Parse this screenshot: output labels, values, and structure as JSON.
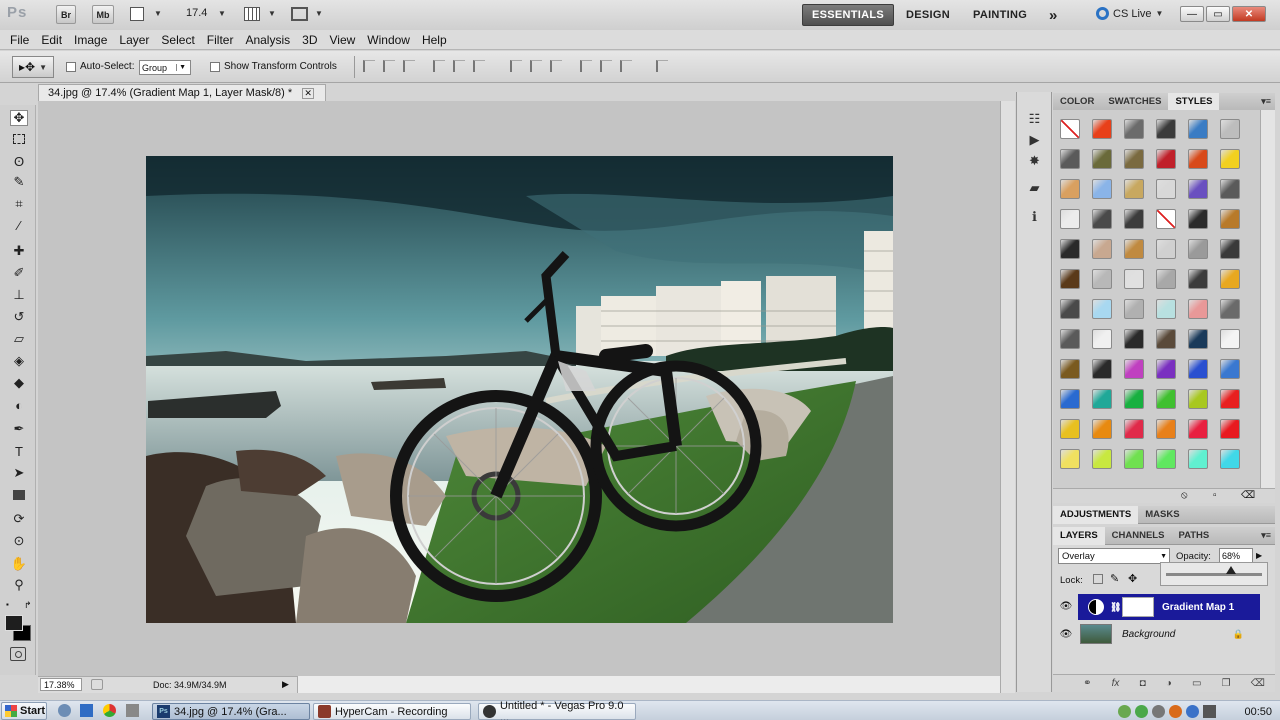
{
  "app": {
    "logo": "Ps",
    "bridge_label": "Br",
    "minibridge_label": "Mb",
    "zoom_value": "17.4",
    "workspaces": [
      "ESSENTIALS",
      "DESIGN",
      "PAINTING"
    ],
    "more_label": "»",
    "cs_live": "CS Live",
    "window_controls": [
      "—",
      "▭",
      "✕"
    ]
  },
  "menu": [
    "File",
    "Edit",
    "Image",
    "Layer",
    "Select",
    "Filter",
    "Analysis",
    "3D",
    "View",
    "Window",
    "Help"
  ],
  "options": {
    "auto_select_label": "Auto-Select:",
    "auto_select_value": "Group",
    "transform_label": "Show Transform Controls"
  },
  "document": {
    "tab_title": "34.jpg @ 17.4% (Gradient Map 1, Layer Mask/8) *",
    "close": "✕",
    "zoom_status": "17.38%",
    "doc_status": "Doc: 34.9M/34.9M"
  },
  "styles_panel": {
    "tabs": [
      "COLOR",
      "SWATCHES",
      "STYLES"
    ],
    "active_tab": "STYLES",
    "swatches": [
      "none",
      "#e8401a",
      "#6b6b6b",
      "#3b3b3b",
      "#3a7cc4",
      "#bdbdbd",
      "#5a5a5a",
      "#6a6a3a",
      "#7a6a40",
      "#c0202a",
      "#d84a1a",
      "#f2d020",
      "#d9a060",
      "#8ab4e8",
      "#c8a860",
      "#d8d8d8",
      "#6a50c0",
      "#5a5a5a",
      "#ececec",
      "#4a4a4a",
      "#3c3c3c",
      "none",
      "#2c2c2c",
      "#b87a2a",
      "#2a2a2a",
      "#c8a890",
      "#c08a40",
      "#d0d0d0",
      "#9a9a9a",
      "#3a3a3a",
      "#5a3a1a",
      "#b8b8b8",
      "#e0e0e0",
      "#a8a8a8",
      "#3c3c3c",
      "#e8a820",
      "#4a4a4a",
      "#a8d8f0",
      "#b0b0b0",
      "#b8e0e0",
      "#e89898",
      "#6a6a6a",
      "#5a5a5a",
      "#f0f0f0",
      "#2a2a2a",
      "#5a4a3a",
      "#1a3a5a",
      "#f4f4f4",
      "#7a5a20",
      "#2a2a2a",
      "#c040c0",
      "#7a30c0",
      "#2a50d0",
      "#3a78d0",
      "#2a6ad0",
      "#20a898",
      "#18b040",
      "#40c030",
      "#a8c820",
      "#e82020",
      "#e8c020",
      "#e88a10",
      "#e02a4a",
      "#e8801a",
      "#e82040",
      "#e81a20",
      "#f0e060",
      "#c8e840",
      "#70e050",
      "#60e860",
      "#60f0d0",
      "#40d8e8"
    ]
  },
  "adjustments_panel": {
    "tabs": [
      "ADJUSTMENTS",
      "MASKS"
    ]
  },
  "layers_panel": {
    "tabs": [
      "LAYERS",
      "CHANNELS",
      "PATHS"
    ],
    "blend_mode": "Overlay",
    "opacity_label": "Opacity:",
    "opacity_value": "68%",
    "opacity_fraction": 0.68,
    "lock_label": "Lock:",
    "layers": [
      {
        "name": "Gradient Map 1",
        "selected": true
      },
      {
        "name": "Background",
        "selected": false
      }
    ],
    "footer_icons": [
      "link-icon",
      "fx-icon",
      "mask-icon",
      "adjustment-icon",
      "folder-icon",
      "new-layer-icon",
      "trash-icon"
    ]
  },
  "taskbar": {
    "start_label": "Start",
    "tasks": [
      {
        "label": "34.jpg @ 17.4% (Gra...",
        "active": true
      },
      {
        "label": "HyperCam - Recording",
        "active": false
      },
      {
        "label": "Untitled * - Vegas Pro 9.0 ...",
        "active": false
      }
    ],
    "clock": "00:50"
  }
}
